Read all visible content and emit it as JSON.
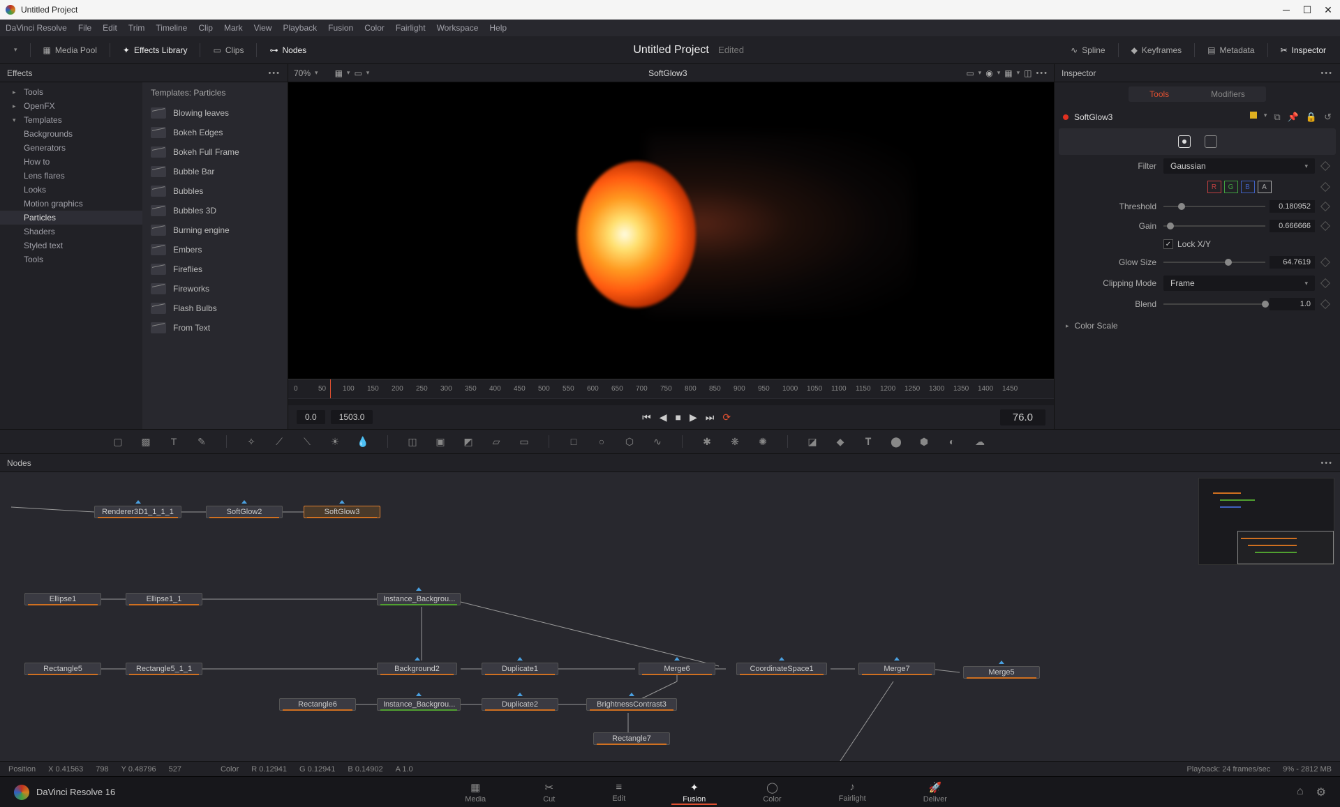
{
  "window": {
    "title": "Untitled Project"
  },
  "menus": [
    "DaVinci Resolve",
    "File",
    "Edit",
    "Trim",
    "Timeline",
    "Clip",
    "Mark",
    "View",
    "Playback",
    "Fusion",
    "Color",
    "Fairlight",
    "Workspace",
    "Help"
  ],
  "toolbar": {
    "media_pool": "Media Pool",
    "effects_library": "Effects Library",
    "clips": "Clips",
    "nodes": "Nodes",
    "spline": "Spline",
    "keyframes": "Keyframes",
    "metadata": "Metadata",
    "inspector": "Inspector"
  },
  "project": {
    "title": "Untitled Project",
    "edited": "Edited"
  },
  "effects_panel": {
    "title": "Effects"
  },
  "effects_tree": {
    "tools": "Tools",
    "openfx": "OpenFX",
    "templates": "Templates",
    "children": [
      "Backgrounds",
      "Generators",
      "How to",
      "Lens flares",
      "Looks",
      "Motion graphics",
      "Particles",
      "Shaders",
      "Styled text",
      "Tools"
    ]
  },
  "templates_header": "Templates: Particles",
  "templates": [
    "Blowing leaves",
    "Bokeh Edges",
    "Bokeh Full Frame",
    "Bubble Bar",
    "Bubbles",
    "Bubbles 3D",
    "Burning engine",
    "Embers",
    "Fireflies",
    "Fireworks",
    "Flash Bulbs",
    "From Text"
  ],
  "viewer": {
    "zoom": "70%",
    "node": "SoftGlow3",
    "start": "0.0",
    "end": "1503.0",
    "current": "76.0",
    "ticks": [
      "0",
      "50",
      "100",
      "150",
      "200",
      "250",
      "300",
      "350",
      "400",
      "450",
      "500",
      "550",
      "600",
      "650",
      "700",
      "750",
      "800",
      "850",
      "900",
      "950",
      "1000",
      "1050",
      "1100",
      "1150",
      "1200",
      "1250",
      "1300",
      "1350",
      "1400",
      "1450"
    ]
  },
  "inspector": {
    "title": "Inspector",
    "tab_tools": "Tools",
    "tab_modifiers": "Modifiers",
    "node_name": "SoftGlow3",
    "filter_label": "Filter",
    "filter_value": "Gaussian",
    "channels": [
      "R",
      "G",
      "B",
      "A"
    ],
    "threshold_label": "Threshold",
    "threshold_value": "0.180952",
    "gain_label": "Gain",
    "gain_value": "0.666666",
    "lock_label": "Lock X/Y",
    "glow_label": "Glow Size",
    "glow_value": "64.7619",
    "clipping_label": "Clipping Mode",
    "clipping_value": "Frame",
    "blend_label": "Blend",
    "blend_value": "1.0",
    "colorscale": "Color Scale"
  },
  "nodes_panel": {
    "title": "Nodes"
  },
  "flow_nodes": {
    "renderer": "Renderer3D1_1_1_1",
    "sg2": "SoftGlow2",
    "sg3": "SoftGlow3",
    "el1": "Ellipse1",
    "el11": "Ellipse1_1",
    "inst_bg1": "Instance_Backgrou...",
    "rect5": "Rectangle5",
    "rect511": "Rectangle5_1_1",
    "bg2": "Background2",
    "dup1": "Duplicate1",
    "merge6": "Merge6",
    "coord": "CoordinateSpace1",
    "merge7": "Merge7",
    "merge5": "Merge5",
    "rect6": "Rectangle6",
    "inst_bg2": "Instance_Backgrou...",
    "dup2": "Duplicate2",
    "bc3": "BrightnessContrast3",
    "rect7": "Rectangle7"
  },
  "status": {
    "pos_label": "Position",
    "x": "X 0.41563",
    "xp": "798",
    "y": "Y 0.48796",
    "yp": "527",
    "color_label": "Color",
    "r": "R 0.12941",
    "g": "G 0.12941",
    "b": "B 0.14902",
    "a": "A 1.0",
    "playback": "Playback: 24 frames/sec",
    "mem": "9% - 2812 MB"
  },
  "pages": {
    "brand": "DaVinci Resolve 16",
    "items": [
      "Media",
      "Cut",
      "Edit",
      "Fusion",
      "Color",
      "Fairlight",
      "Deliver"
    ]
  }
}
